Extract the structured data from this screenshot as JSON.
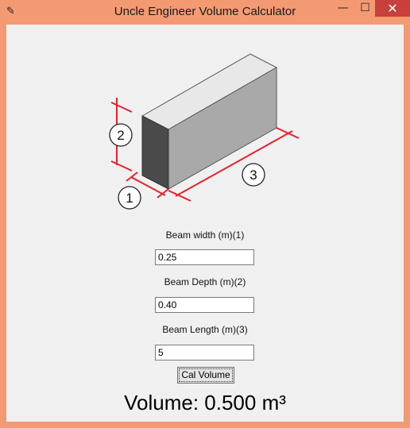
{
  "window": {
    "title": "Uncle Engineer Volume Calculator",
    "minimize_glyph": "—",
    "maximize_glyph": "☐",
    "close_glyph": "✕"
  },
  "diagram": {
    "markers": [
      "1",
      "2",
      "3"
    ]
  },
  "form": {
    "width_label": "Beam width (m)(1)",
    "width_value": "0.25",
    "depth_label": "Beam Depth (m)(2)",
    "depth_value": "0.40",
    "length_label": "Beam Length (m)(3)",
    "length_value": "5",
    "calc_button": "Cal Volume"
  },
  "result": {
    "text": "Volume: 0.500 m³"
  },
  "colors": {
    "titlebar": "#f39a72",
    "close_button": "#c7403c",
    "dimension_lines": "#e8202a"
  }
}
